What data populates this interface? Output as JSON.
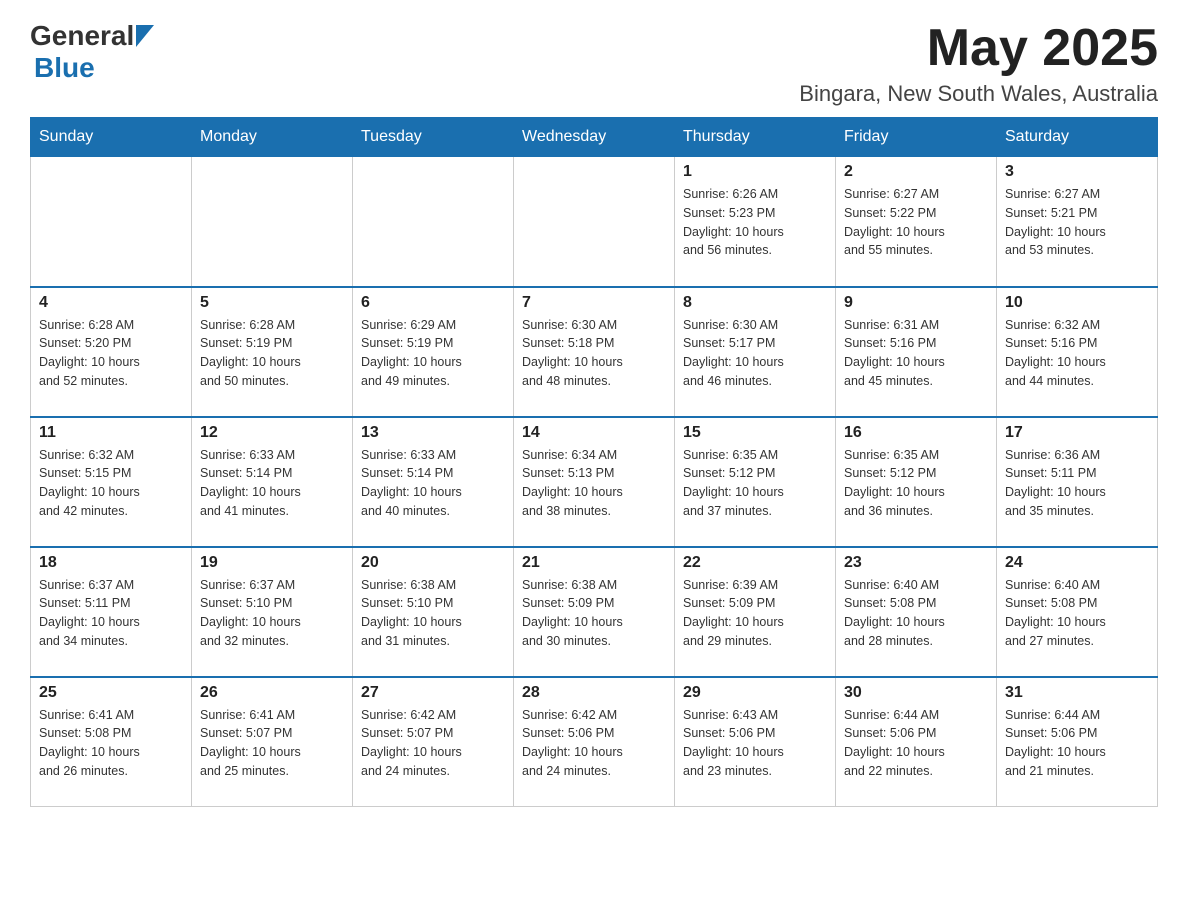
{
  "header": {
    "logo_general": "General",
    "logo_blue": "Blue",
    "month_year": "May 2025",
    "location": "Bingara, New South Wales, Australia"
  },
  "days_of_week": [
    "Sunday",
    "Monday",
    "Tuesday",
    "Wednesday",
    "Thursday",
    "Friday",
    "Saturday"
  ],
  "weeks": [
    [
      {
        "day": "",
        "info": ""
      },
      {
        "day": "",
        "info": ""
      },
      {
        "day": "",
        "info": ""
      },
      {
        "day": "",
        "info": ""
      },
      {
        "day": "1",
        "info": "Sunrise: 6:26 AM\nSunset: 5:23 PM\nDaylight: 10 hours\nand 56 minutes."
      },
      {
        "day": "2",
        "info": "Sunrise: 6:27 AM\nSunset: 5:22 PM\nDaylight: 10 hours\nand 55 minutes."
      },
      {
        "day": "3",
        "info": "Sunrise: 6:27 AM\nSunset: 5:21 PM\nDaylight: 10 hours\nand 53 minutes."
      }
    ],
    [
      {
        "day": "4",
        "info": "Sunrise: 6:28 AM\nSunset: 5:20 PM\nDaylight: 10 hours\nand 52 minutes."
      },
      {
        "day": "5",
        "info": "Sunrise: 6:28 AM\nSunset: 5:19 PM\nDaylight: 10 hours\nand 50 minutes."
      },
      {
        "day": "6",
        "info": "Sunrise: 6:29 AM\nSunset: 5:19 PM\nDaylight: 10 hours\nand 49 minutes."
      },
      {
        "day": "7",
        "info": "Sunrise: 6:30 AM\nSunset: 5:18 PM\nDaylight: 10 hours\nand 48 minutes."
      },
      {
        "day": "8",
        "info": "Sunrise: 6:30 AM\nSunset: 5:17 PM\nDaylight: 10 hours\nand 46 minutes."
      },
      {
        "day": "9",
        "info": "Sunrise: 6:31 AM\nSunset: 5:16 PM\nDaylight: 10 hours\nand 45 minutes."
      },
      {
        "day": "10",
        "info": "Sunrise: 6:32 AM\nSunset: 5:16 PM\nDaylight: 10 hours\nand 44 minutes."
      }
    ],
    [
      {
        "day": "11",
        "info": "Sunrise: 6:32 AM\nSunset: 5:15 PM\nDaylight: 10 hours\nand 42 minutes."
      },
      {
        "day": "12",
        "info": "Sunrise: 6:33 AM\nSunset: 5:14 PM\nDaylight: 10 hours\nand 41 minutes."
      },
      {
        "day": "13",
        "info": "Sunrise: 6:33 AM\nSunset: 5:14 PM\nDaylight: 10 hours\nand 40 minutes."
      },
      {
        "day": "14",
        "info": "Sunrise: 6:34 AM\nSunset: 5:13 PM\nDaylight: 10 hours\nand 38 minutes."
      },
      {
        "day": "15",
        "info": "Sunrise: 6:35 AM\nSunset: 5:12 PM\nDaylight: 10 hours\nand 37 minutes."
      },
      {
        "day": "16",
        "info": "Sunrise: 6:35 AM\nSunset: 5:12 PM\nDaylight: 10 hours\nand 36 minutes."
      },
      {
        "day": "17",
        "info": "Sunrise: 6:36 AM\nSunset: 5:11 PM\nDaylight: 10 hours\nand 35 minutes."
      }
    ],
    [
      {
        "day": "18",
        "info": "Sunrise: 6:37 AM\nSunset: 5:11 PM\nDaylight: 10 hours\nand 34 minutes."
      },
      {
        "day": "19",
        "info": "Sunrise: 6:37 AM\nSunset: 5:10 PM\nDaylight: 10 hours\nand 32 minutes."
      },
      {
        "day": "20",
        "info": "Sunrise: 6:38 AM\nSunset: 5:10 PM\nDaylight: 10 hours\nand 31 minutes."
      },
      {
        "day": "21",
        "info": "Sunrise: 6:38 AM\nSunset: 5:09 PM\nDaylight: 10 hours\nand 30 minutes."
      },
      {
        "day": "22",
        "info": "Sunrise: 6:39 AM\nSunset: 5:09 PM\nDaylight: 10 hours\nand 29 minutes."
      },
      {
        "day": "23",
        "info": "Sunrise: 6:40 AM\nSunset: 5:08 PM\nDaylight: 10 hours\nand 28 minutes."
      },
      {
        "day": "24",
        "info": "Sunrise: 6:40 AM\nSunset: 5:08 PM\nDaylight: 10 hours\nand 27 minutes."
      }
    ],
    [
      {
        "day": "25",
        "info": "Sunrise: 6:41 AM\nSunset: 5:08 PM\nDaylight: 10 hours\nand 26 minutes."
      },
      {
        "day": "26",
        "info": "Sunrise: 6:41 AM\nSunset: 5:07 PM\nDaylight: 10 hours\nand 25 minutes."
      },
      {
        "day": "27",
        "info": "Sunrise: 6:42 AM\nSunset: 5:07 PM\nDaylight: 10 hours\nand 24 minutes."
      },
      {
        "day": "28",
        "info": "Sunrise: 6:42 AM\nSunset: 5:06 PM\nDaylight: 10 hours\nand 24 minutes."
      },
      {
        "day": "29",
        "info": "Sunrise: 6:43 AM\nSunset: 5:06 PM\nDaylight: 10 hours\nand 23 minutes."
      },
      {
        "day": "30",
        "info": "Sunrise: 6:44 AM\nSunset: 5:06 PM\nDaylight: 10 hours\nand 22 minutes."
      },
      {
        "day": "31",
        "info": "Sunrise: 6:44 AM\nSunset: 5:06 PM\nDaylight: 10 hours\nand 21 minutes."
      }
    ]
  ]
}
